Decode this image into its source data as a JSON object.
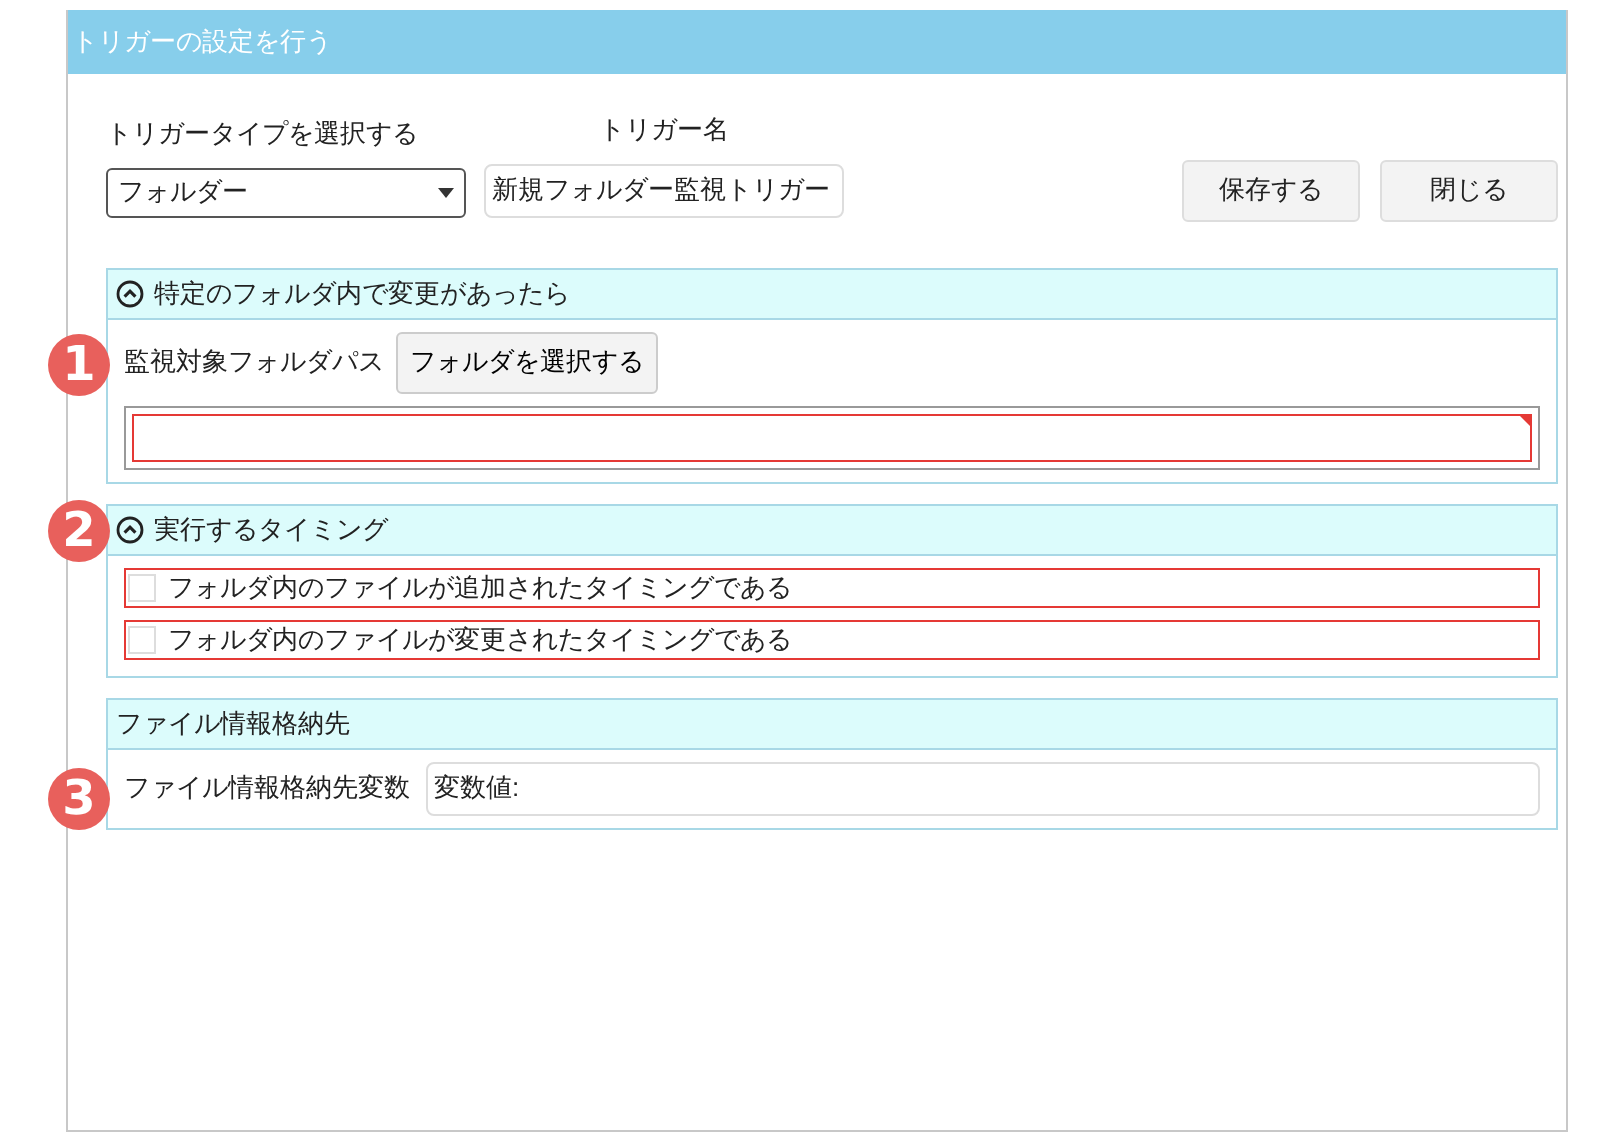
{
  "window": {
    "title": "トリガーの設定を行う"
  },
  "trigger_type": {
    "label": "トリガータイプを選択する",
    "value": "フォルダー"
  },
  "trigger_name": {
    "label": "トリガー名",
    "value": "新規フォルダー監視トリガー"
  },
  "buttons": [
    "保存する",
    "閉じる"
  ],
  "sections": [
    {
      "kind": "folder",
      "title": "特定のフォルダ内で変更があったら",
      "expanded": true,
      "marker": "1",
      "label": "監視対象フォルダパス",
      "button": "フォルダを選択する",
      "path_field": {
        "invalid": true
      }
    },
    {
      "kind": "checks",
      "title": "実行するタイミング",
      "expanded": true,
      "marker": "2",
      "options": [
        {
          "label": "フォルダ内のファイルが追加されたタイミングである",
          "checked": false,
          "invalid": true
        },
        {
          "label": "フォルダ内のファイルが変更されたタイミングである",
          "checked": false,
          "invalid": true
        }
      ]
    },
    {
      "kind": "variable",
      "title": "ファイル情報格納先",
      "marker": "3",
      "label": "ファイル情報格納先変数",
      "value": "変数値:"
    }
  ]
}
